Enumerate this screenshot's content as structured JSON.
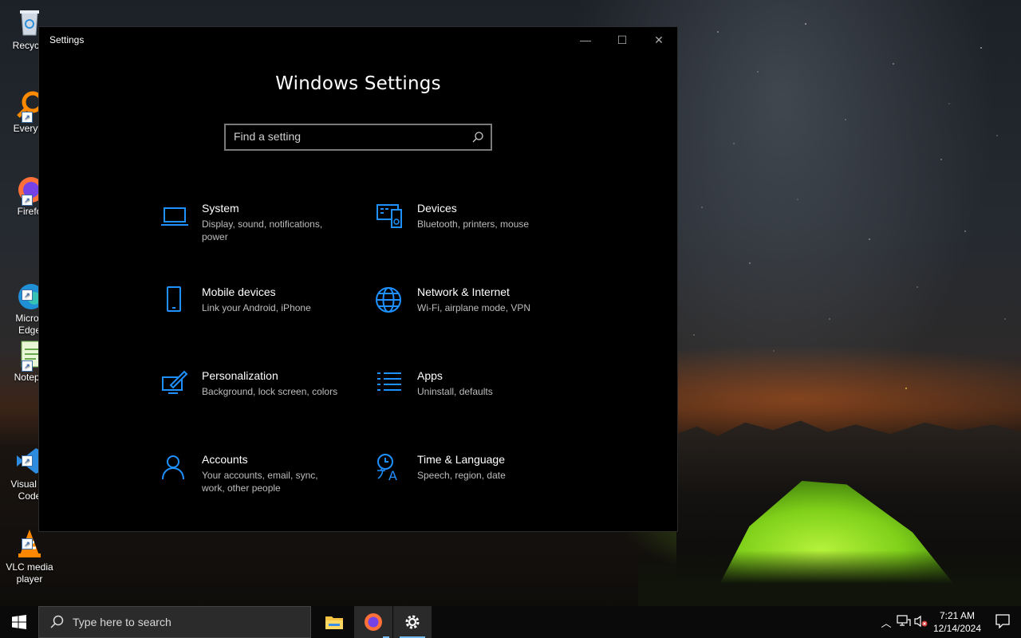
{
  "desktop": {
    "icons": [
      {
        "label": "Recycle",
        "icon": "recycle-bin-icon"
      },
      {
        "label": "Everyth",
        "icon": "everything-search-icon"
      },
      {
        "label": "Firefo",
        "icon": "firefox-icon"
      },
      {
        "label": "Micros\nEdge",
        "icon": "edge-icon"
      },
      {
        "label": "Notepa",
        "icon": "notepad-plus-icon"
      },
      {
        "label": "Visual St\nCode",
        "icon": "vscode-icon"
      },
      {
        "label": "VLC media\nplayer",
        "icon": "vlc-icon"
      }
    ]
  },
  "window": {
    "title": "Settings",
    "heading": "Windows Settings",
    "search_placeholder": "Find a setting",
    "accent": "#1e90ff",
    "tiles": [
      {
        "name": "System",
        "desc": "Display, sound, notifications, power",
        "icon": "laptop-icon"
      },
      {
        "name": "Devices",
        "desc": "Bluetooth, printers, mouse",
        "icon": "devices-icon"
      },
      {
        "name": "Mobile devices",
        "desc": "Link your Android, iPhone",
        "icon": "phone-icon"
      },
      {
        "name": "Network & Internet",
        "desc": "Wi-Fi, airplane mode, VPN",
        "icon": "globe-icon"
      },
      {
        "name": "Personalization",
        "desc": "Background, lock screen, colors",
        "icon": "paint-icon"
      },
      {
        "name": "Apps",
        "desc": "Uninstall, defaults",
        "icon": "apps-list-icon"
      },
      {
        "name": "Accounts",
        "desc": "Your accounts, email, sync, work, other people",
        "icon": "person-icon"
      },
      {
        "name": "Time & Language",
        "desc": "Speech, region, date",
        "icon": "time-language-icon"
      }
    ]
  },
  "taskbar": {
    "search_placeholder": "Type here to search",
    "apps": [
      "file-explorer-icon",
      "firefox-icon",
      "settings-gear-icon"
    ],
    "time": "7:21 AM",
    "date": "12/14/2024"
  }
}
